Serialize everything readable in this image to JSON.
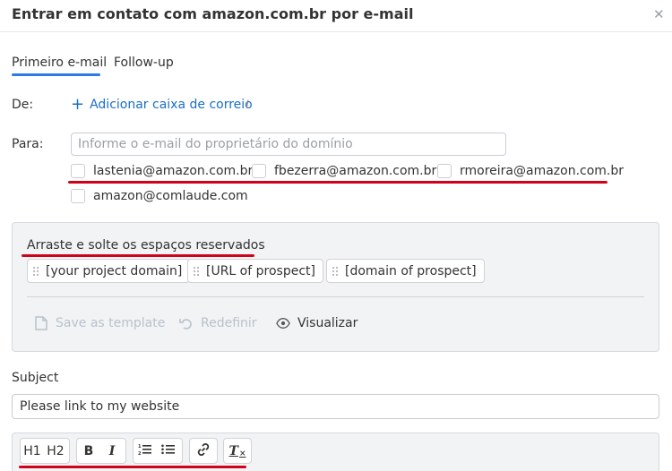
{
  "dialog": {
    "title": "Entrar em contato com amazon.com.br por e-mail",
    "close_glyph": "✕"
  },
  "tabs": [
    {
      "label": "Primeiro e-mail",
      "active": true
    },
    {
      "label": "Follow-up",
      "active": false
    }
  ],
  "from": {
    "label": "De:",
    "add_mailbox_label": "Adicionar caixa de correio",
    "plus_glyph": "+",
    "info_glyph": "i"
  },
  "to": {
    "label": "Para:",
    "placeholder": "Informe o e-mail do proprietário do domínio",
    "value": "",
    "suggestions": [
      "lastenia@amazon.com.br",
      "fbezerra@amazon.com.br",
      "rmoreira@amazon.com.br",
      "amazon@comlaude.com"
    ]
  },
  "placeholders_panel": {
    "title": "Arraste e solte os espaços reservados",
    "chips": [
      "[your project domain]",
      "[URL of prospect]",
      "[domain of prospect]"
    ],
    "actions": {
      "save_template": "Save as template",
      "reset": "Redefinir",
      "preview": "Visualizar"
    }
  },
  "subject": {
    "label": "Subject",
    "value": "Please link to my website"
  },
  "editor_toolbar": {
    "h1": "H1",
    "h2": "H2",
    "bold": "B",
    "italic": "I",
    "clear": "T"
  },
  "colors": {
    "accent": "#2c7be5",
    "link": "#1a6fc9",
    "annotation_red": "#d0021b",
    "panel_bg": "#f2f3f5"
  }
}
